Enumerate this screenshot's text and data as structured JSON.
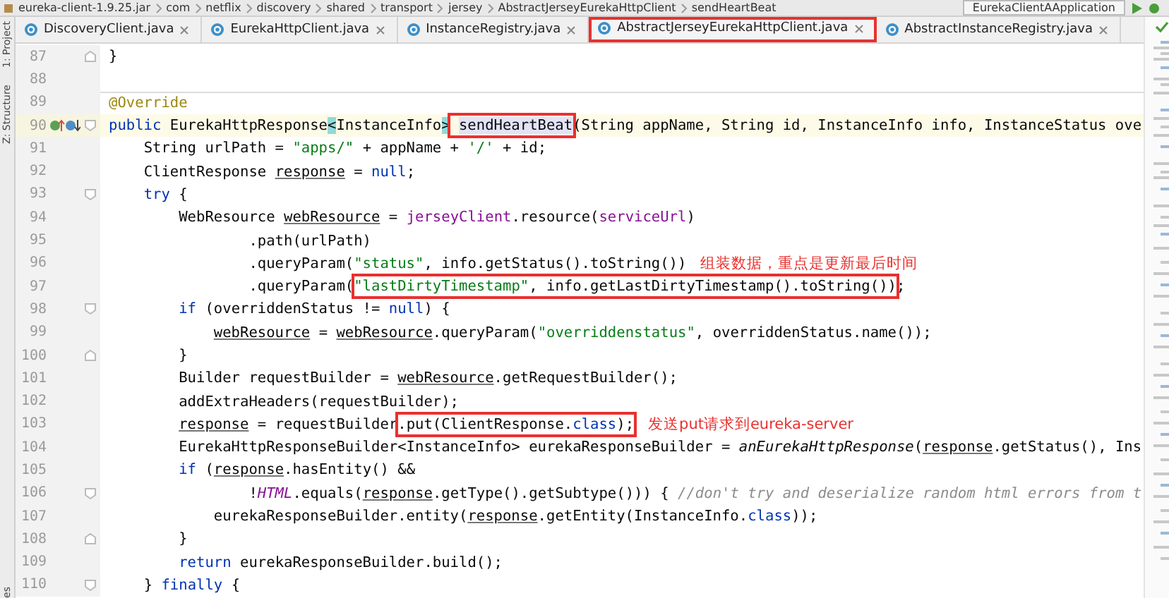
{
  "breadcrumbs": [
    "eureka-client-1.9.25.jar",
    "com",
    "netflix",
    "discovery",
    "shared",
    "transport",
    "jersey",
    "AbstractJerseyEurekaHttpClient",
    "sendHeartBeat"
  ],
  "run_config": "EurekaClientAApplication",
  "side_panels": [
    "1: Project",
    "Z: Structure"
  ],
  "side_panels_bottom": "es",
  "tabs": [
    {
      "label": "DiscoveryClient.java",
      "selected": false,
      "boxed": false
    },
    {
      "label": "EurekaHttpClient.java",
      "selected": false,
      "boxed": false
    },
    {
      "label": "InstanceRegistry.java",
      "selected": false,
      "boxed": false
    },
    {
      "label": "AbstractJerseyEurekaHttpClient.java",
      "selected": true,
      "boxed": true
    },
    {
      "label": "AbstractInstanceRegistry.java",
      "selected": false,
      "boxed": false
    }
  ],
  "editor": {
    "lines": [
      {
        "number": "87",
        "current": false,
        "fold": {
          "kind": "end"
        },
        "tokens": [
          {
            "kind": "plain",
            "text": "}"
          }
        ]
      },
      {
        "number": "88",
        "current": false
      },
      {
        "number": "89",
        "current": false,
        "tokens": [
          {
            "kind": "annotation",
            "text": "@Override"
          }
        ]
      },
      {
        "number": "90",
        "current": true,
        "fold": {
          "kind": "start"
        },
        "gutter_icon": {
          "kind": "override"
        },
        "tokens": [
          {
            "kind": "keyword",
            "text": "public"
          },
          {
            "kind": "plain",
            "text": " EurekaHttpResponse"
          },
          {
            "kind": "brace",
            "text": "<"
          },
          {
            "kind": "plain",
            "text": "InstanceInfo"
          },
          {
            "kind": "brace",
            "text": ">"
          },
          {
            "kind": "usage",
            "text": "sendHeartBeat",
            "boxed": true
          },
          {
            "kind": "plain",
            "text": "(String appName, String id, InstanceInfo info, InstanceStatus ove"
          }
        ]
      },
      {
        "number": "91",
        "current": false,
        "tokens": [
          {
            "kind": "plain",
            "text": "    String urlPath = "
          },
          {
            "kind": "string",
            "text": "\"apps/\""
          },
          {
            "kind": "plain",
            "text": " + appName + "
          },
          {
            "kind": "string",
            "text": "'/'"
          },
          {
            "kind": "plain",
            "text": " + id;"
          }
        ]
      },
      {
        "number": "92",
        "current": false,
        "tokens": [
          {
            "kind": "plain",
            "text": "    ClientResponse "
          },
          {
            "kind": "var",
            "text": "response"
          },
          {
            "kind": "plain",
            "text": " = "
          },
          {
            "kind": "keyword",
            "text": "null"
          },
          {
            "kind": "plain",
            "text": ";"
          }
        ]
      },
      {
        "number": "93",
        "current": false,
        "fold": {
          "kind": "start"
        },
        "tokens": [
          {
            "kind": "keyword",
            "text": "    try"
          },
          {
            "kind": "plain",
            "text": " {"
          }
        ]
      },
      {
        "number": "94",
        "current": false,
        "tokens": [
          {
            "kind": "plain",
            "text": "        WebResource "
          },
          {
            "kind": "var",
            "text": "webResource"
          },
          {
            "kind": "plain",
            "text": " = "
          },
          {
            "kind": "field",
            "text": "jerseyClient"
          },
          {
            "kind": "plain",
            "text": ".resource("
          },
          {
            "kind": "field",
            "text": "serviceUrl"
          },
          {
            "kind": "plain",
            "text": ")"
          }
        ]
      },
      {
        "number": "95",
        "current": false,
        "tokens": [
          {
            "kind": "plain",
            "text": "                .path(urlPath)"
          }
        ]
      },
      {
        "number": "96",
        "current": false,
        "note": "组装数据，重点是更新最后时间",
        "tokens": [
          {
            "kind": "plain",
            "text": "                .queryParam("
          },
          {
            "kind": "string",
            "text": "\"status\""
          },
          {
            "kind": "plain",
            "text": ", info.getStatus().toString())"
          }
        ]
      },
      {
        "number": "97",
        "current": false,
        "tokens": [
          {
            "kind": "plain",
            "text": "                .queryParam("
          },
          {
            "kind": "string",
            "text": "\"lastDirtyTimestamp\"",
            "boxed": true
          },
          {
            "kind": "plain",
            "text": ", info.getLastDirtyTimestamp().toString())",
            "boxed": true
          },
          {
            "kind": "plain",
            "text": ";"
          }
        ]
      },
      {
        "number": "98",
        "current": false,
        "fold": {
          "kind": "start"
        },
        "tokens": [
          {
            "kind": "keyword",
            "text": "        if"
          },
          {
            "kind": "plain",
            "text": " (overriddenStatus != "
          },
          {
            "kind": "keyword",
            "text": "null"
          },
          {
            "kind": "plain",
            "text": ") {"
          }
        ]
      },
      {
        "number": "99",
        "current": false,
        "tokens": [
          {
            "kind": "var",
            "text": "            webResource"
          },
          {
            "kind": "plain",
            "text": " = "
          },
          {
            "kind": "var",
            "text": "webResource"
          },
          {
            "kind": "plain",
            "text": ".queryParam("
          },
          {
            "kind": "string",
            "text": "\"overriddenstatus\""
          },
          {
            "kind": "plain",
            "text": ", overriddenStatus.name());"
          }
        ]
      },
      {
        "number": "100",
        "current": false,
        "fold": {
          "kind": "end"
        },
        "tokens": [
          {
            "kind": "plain",
            "text": "        }"
          }
        ]
      },
      {
        "number": "101",
        "current": false,
        "tokens": [
          {
            "kind": "plain",
            "text": "        Builder requestBuilder = "
          },
          {
            "kind": "var",
            "text": "webResource"
          },
          {
            "kind": "plain",
            "text": ".getRequestBuilder();"
          }
        ]
      },
      {
        "number": "102",
        "current": false,
        "tokens": [
          {
            "kind": "plain",
            "text": "        addExtraHeaders(requestBuilder);"
          }
        ]
      },
      {
        "number": "103",
        "current": false,
        "note": "发送put请求到eureka-server",
        "tokens": [
          {
            "kind": "var",
            "text": "        response"
          },
          {
            "kind": "plain",
            "text": " = requestBuilder"
          },
          {
            "kind": "plain",
            "text": ".put(ClientResponse.",
            "boxed": true
          },
          {
            "kind": "keyword",
            "text": "class",
            "boxed": true
          },
          {
            "kind": "plain",
            "text": ");",
            "boxed": true
          }
        ]
      },
      {
        "number": "104",
        "current": false,
        "tokens": [
          {
            "kind": "plain",
            "text": "        EurekaHttpResponseBuilder<InstanceInfo> eurekaResponseBuilder = "
          },
          {
            "kind": "method",
            "text": "anEurekaHttpResponse"
          },
          {
            "kind": "plain",
            "text": "("
          },
          {
            "kind": "var",
            "text": "response"
          },
          {
            "kind": "plain",
            "text": ".getStatus(), Ins"
          }
        ]
      },
      {
        "number": "105",
        "current": false,
        "tokens": [
          {
            "kind": "keyword",
            "text": "        if"
          },
          {
            "kind": "plain",
            "text": " ("
          },
          {
            "kind": "var",
            "text": "response"
          },
          {
            "kind": "plain",
            "text": ".hasEntity() &&"
          }
        ]
      },
      {
        "number": "106",
        "current": false,
        "fold": {
          "kind": "start"
        },
        "tokens": [
          {
            "kind": "plain",
            "text": "                !"
          },
          {
            "kind": "static",
            "text": "HTML"
          },
          {
            "kind": "plain",
            "text": ".equals("
          },
          {
            "kind": "var",
            "text": "response"
          },
          {
            "kind": "plain",
            "text": ".getType().getSubtype())) { "
          },
          {
            "kind": "comment",
            "text": "//don't try and deserialize random html errors from t"
          }
        ]
      },
      {
        "number": "107",
        "current": false,
        "tokens": [
          {
            "kind": "plain",
            "text": "            eurekaResponseBuilder.entity("
          },
          {
            "kind": "var",
            "text": "response"
          },
          {
            "kind": "plain",
            "text": ".getEntity(InstanceInfo."
          },
          {
            "kind": "keyword",
            "text": "class"
          },
          {
            "kind": "plain",
            "text": "));"
          }
        ]
      },
      {
        "number": "108",
        "current": false,
        "fold": {
          "kind": "end"
        },
        "tokens": [
          {
            "kind": "plain",
            "text": "        }"
          }
        ]
      },
      {
        "number": "109",
        "current": false,
        "tokens": [
          {
            "kind": "keyword",
            "text": "        return"
          },
          {
            "kind": "plain",
            "text": " eurekaResponseBuilder.build();"
          }
        ]
      },
      {
        "number": "110",
        "current": false,
        "fold": {
          "kind": "start"
        },
        "tokens": [
          {
            "kind": "plain",
            "text": "    } "
          },
          {
            "kind": "keyword",
            "text": "finally"
          },
          {
            "kind": "plain",
            "text": " {"
          }
        ]
      }
    ]
  }
}
